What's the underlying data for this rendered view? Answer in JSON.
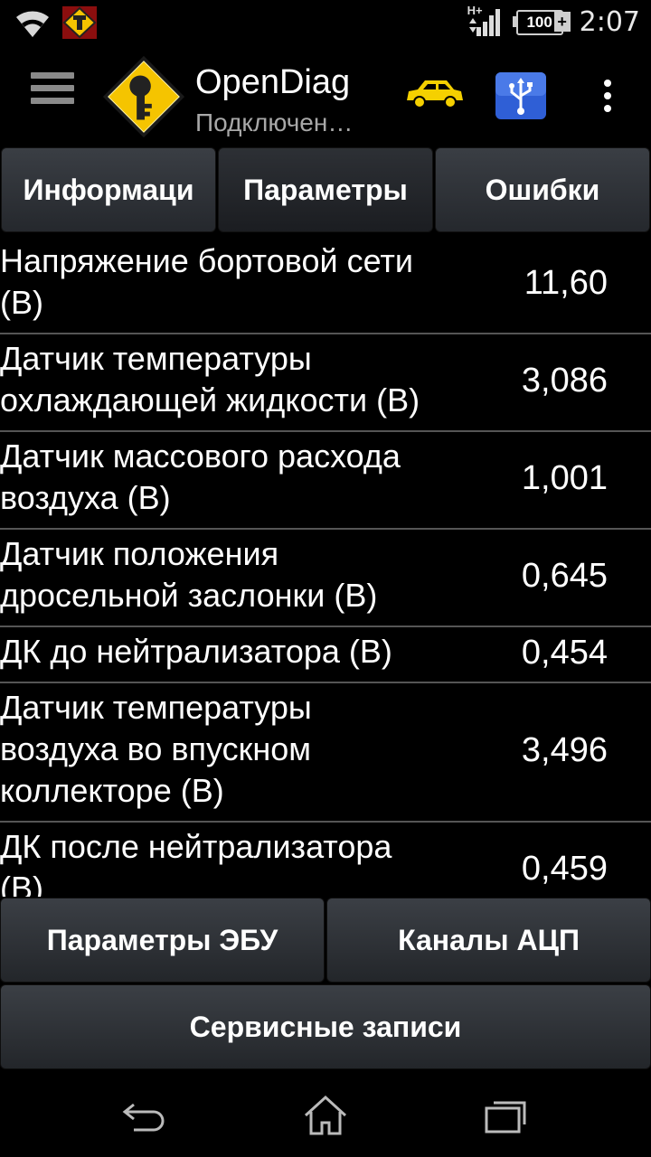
{
  "status_bar": {
    "network_type": "H+",
    "battery_level": "100",
    "time": "2:07",
    "icons": [
      "wifi-icon",
      "app-notification-icon",
      "signal-icon",
      "battery-icon",
      "charging-icon"
    ]
  },
  "action_bar": {
    "title": "OpenDiag",
    "subtitle": "Подключен…",
    "icons": [
      "menu-icon",
      "app-logo",
      "car-icon",
      "usb-icon",
      "overflow-icon"
    ]
  },
  "tabs": [
    {
      "label": "Информаци",
      "active": false
    },
    {
      "label": "Параметры",
      "active": true
    },
    {
      "label": "Ошибки",
      "active": false
    }
  ],
  "parameters": [
    {
      "label_lines": [
        "Напряжение бортовой сети",
        "(В)"
      ],
      "value": "11,60"
    },
    {
      "label_lines": [
        "Датчик температуры",
        "охлаждающей жидкости (В)"
      ],
      "value": "3,086"
    },
    {
      "label_lines": [
        "Датчик массового расхода",
        "воздуха (В)"
      ],
      "value": "1,001"
    },
    {
      "label_lines": [
        "Датчик положения",
        "дросельной заслонки (В)"
      ],
      "value": "0,645"
    },
    {
      "label_lines": [
        "ДК до нейтрализатора (В)"
      ],
      "value": "0,454"
    },
    {
      "label_lines": [
        "Датчик температуры",
        "воздуха во впускном",
        "коллекторе (В)"
      ],
      "value": "3,496"
    },
    {
      "label_lines": [
        "ДК после нейтрализатора",
        "(В)"
      ],
      "value": "0,459"
    }
  ],
  "buttons": {
    "ecu_params": "Параметры ЭБУ",
    "adc_channels": "Каналы АЦП",
    "service_records": "Сервисные записи"
  },
  "colors": {
    "background": "#000000",
    "button_gradient_top": "#3b3f45",
    "button_gradient_bottom": "#23262a",
    "logo_yellow": "#f5c400",
    "usb_blue": "#2f5fd6",
    "subtitle_gray": "#a8a8a8"
  }
}
